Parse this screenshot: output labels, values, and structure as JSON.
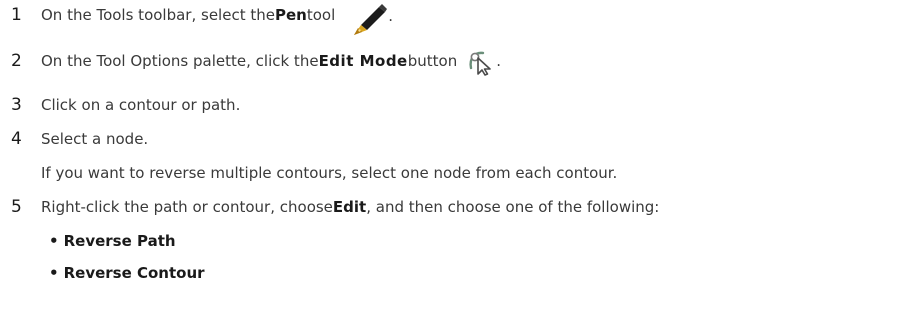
{
  "steps": [
    {
      "num": "1",
      "pre": "On the Tools toolbar, select the ",
      "bold": "Pen",
      "post": " tool",
      "tail": ".",
      "icon": "pen-tool-icon"
    },
    {
      "num": "2",
      "pre": "On the Tool Options palette, click the ",
      "bold": "Edit Mode",
      "post": " button",
      "tail": ".",
      "icon": "edit-mode-icon"
    },
    {
      "num": "3",
      "text": "Click on a contour or path."
    },
    {
      "num": "4",
      "text": "Select a node.",
      "note": "If you want to reverse multiple contours, select one node from each contour."
    },
    {
      "num": "5",
      "pre": "Right-click the path or contour, choose ",
      "bold": "Edit",
      "post": ", and then choose one of the following:"
    }
  ],
  "options": [
    {
      "bullet": "•",
      "label": "Reverse Path"
    },
    {
      "bullet": "•",
      "label": "Reverse Contour"
    }
  ]
}
